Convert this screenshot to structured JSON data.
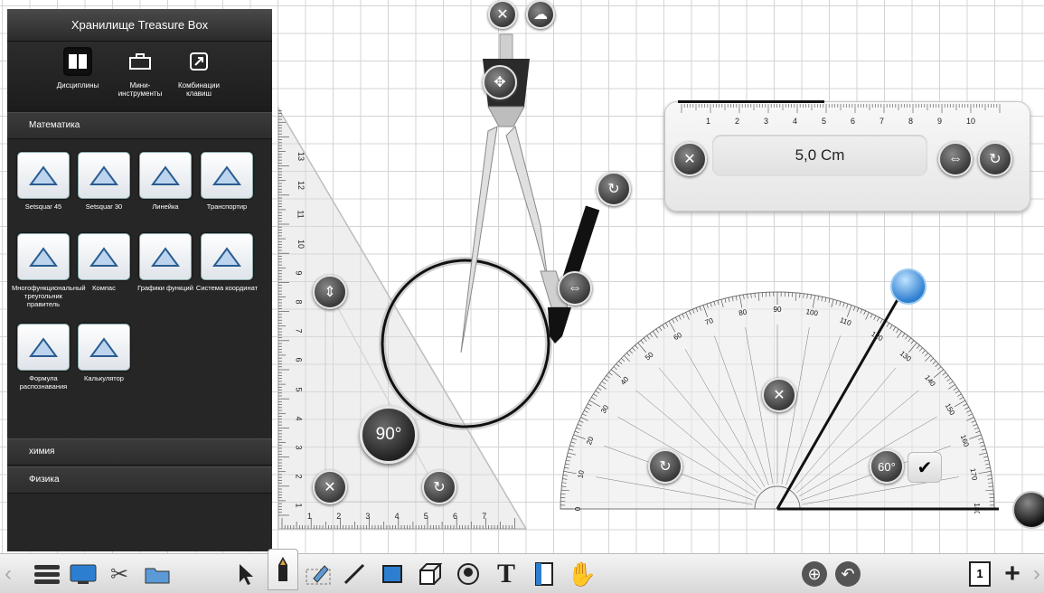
{
  "sidebar": {
    "title": "Хранилище Treasure Box",
    "tabs": [
      {
        "label": "Дисциплины",
        "icon": "book-icon"
      },
      {
        "label": "Мини-инструменты",
        "icon": "toolbox-icon"
      },
      {
        "label": "Комбинации клавиш",
        "icon": "shortcut-arrow-icon"
      }
    ],
    "section_math": "Математика",
    "tools": [
      {
        "label": "Setsquar 45",
        "icon": "setsquare-45-icon"
      },
      {
        "label": "Setsquar 30",
        "icon": "setsquare-30-icon"
      },
      {
        "label": "Линейка",
        "icon": "ruler-icon"
      },
      {
        "label": "Транспортир",
        "icon": "protractor-icon"
      },
      {
        "label": "Многофункциональный треугольник правитель",
        "icon": "multi-triangle-icon"
      },
      {
        "label": "Компас",
        "icon": "compass-icon"
      },
      {
        "label": "Графики функций",
        "icon": "function-graph-icon"
      },
      {
        "label": "Система координат",
        "icon": "coordinate-system-icon"
      },
      {
        "label": "Формула распознавания",
        "icon": "formula-recognition-icon"
      },
      {
        "label": "Калькулятор",
        "icon": "calculator-icon"
      }
    ],
    "section_chemistry": "химия",
    "section_physics": "Физика"
  },
  "ruler": {
    "value": "5,0 Cm",
    "ticks": [
      "1",
      "2",
      "3",
      "4",
      "5",
      "6",
      "7",
      "8",
      "9",
      "10"
    ]
  },
  "triangle": {
    "angle_badge": "90°",
    "v_ticks": [
      "13",
      "12",
      "11",
      "10",
      "9",
      "8",
      "7",
      "6",
      "5",
      "4",
      "3",
      "2",
      "1"
    ],
    "h_ticks": [
      "1",
      "2",
      "3",
      "4",
      "5",
      "6",
      "7"
    ]
  },
  "protractor": {
    "angle_badge": "60°",
    "outer_labels": [
      "0",
      "10",
      "20",
      "30",
      "40",
      "50",
      "60",
      "70",
      "80",
      "90",
      "100",
      "110",
      "120",
      "130",
      "140",
      "150",
      "160",
      "170",
      "180"
    ]
  },
  "toolbar": {
    "page_number": "1"
  },
  "colors": {
    "sidebar_bg": "#262626",
    "grid_line": "#d4d4d4",
    "accent_blue": "#3a8fd6"
  }
}
